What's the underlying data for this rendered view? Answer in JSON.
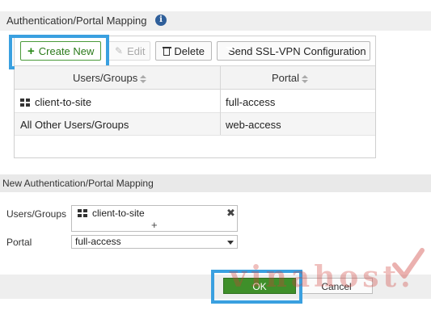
{
  "mapping": {
    "title": "Authentication/Portal Mapping",
    "info_icon": "info-circle-icon",
    "toolbar": {
      "create_label": "Create New",
      "edit_label": "Edit",
      "delete_label": "Delete",
      "ssl_label": "Send SSL-VPN Configuration"
    },
    "columns": [
      "Users/Groups",
      "Portal"
    ],
    "rows": [
      {
        "users": "client-to-site",
        "portal": "full-access"
      },
      {
        "users": "All Other Users/Groups",
        "portal": "web-access"
      }
    ]
  },
  "new_mapping": {
    "title": "New Authentication/Portal Mapping",
    "users_label": "Users/Groups",
    "users_value": "client-to-site",
    "add_symbol": "+",
    "remove_symbol": "✖",
    "portal_label": "Portal",
    "portal_value": "full-access"
  },
  "footer": {
    "ok_label": "OK",
    "cancel_label": "Cancel"
  },
  "watermark": {
    "text": "vinahost.vn"
  },
  "colors": {
    "accent_green": "#3f8f2a",
    "highlight_blue": "#3aa0e0",
    "info_blue": "#2f5f9a"
  }
}
